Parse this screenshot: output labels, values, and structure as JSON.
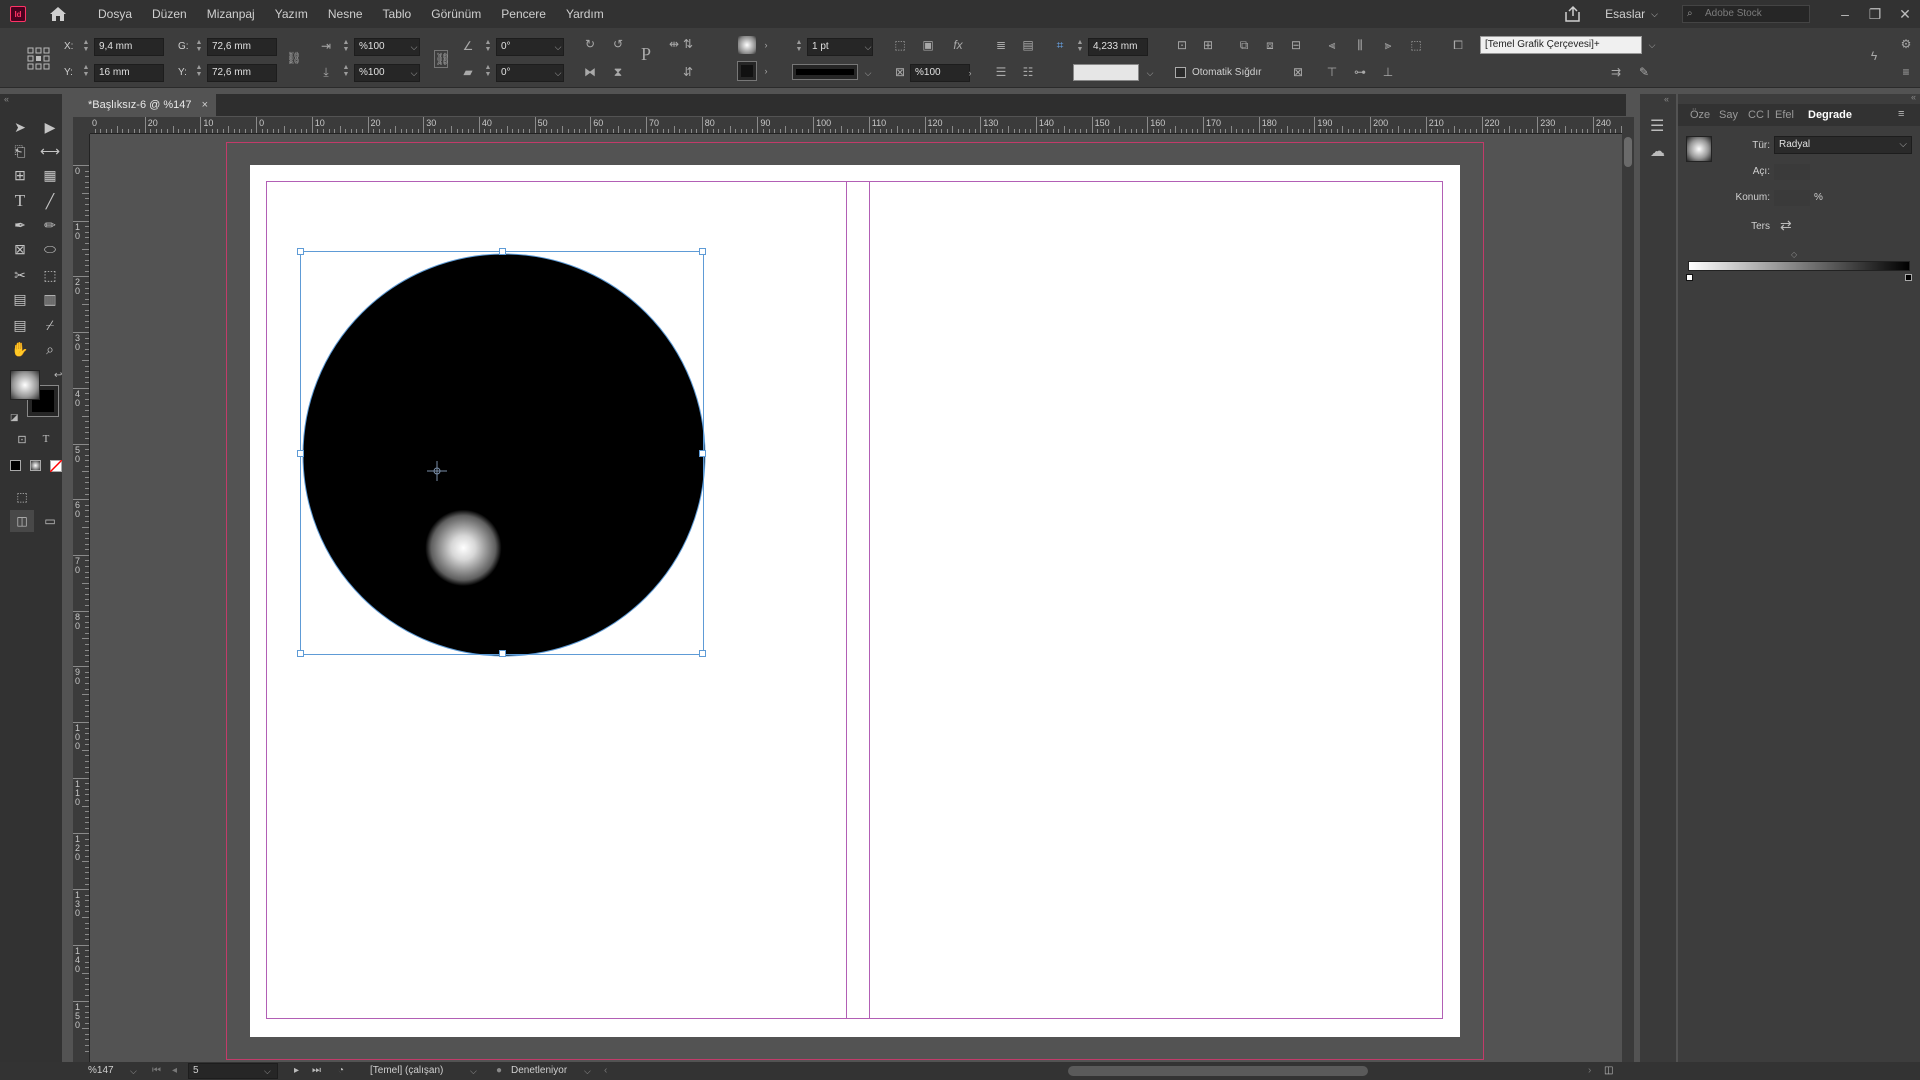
{
  "app": {
    "logo": "Id"
  },
  "menu": [
    "Dosya",
    "Düzen",
    "Mizanpaj",
    "Yazım",
    "Nesne",
    "Tablo",
    "Görünüm",
    "Pencere",
    "Yardım"
  ],
  "workspace": "Esaslar",
  "search_placeholder": "Adobe Stock",
  "control": {
    "x_label": "X:",
    "x_value": "9,4 mm",
    "y_label": "Y:",
    "y_value": "16 mm",
    "w_label": "G:",
    "w_value": "72,6 mm",
    "h_label": "Y:",
    "h_value": "72,6 mm",
    "scale_x": "%100",
    "scale_y": "%100",
    "rotate": "0°",
    "shear": "0°",
    "stroke_weight": "1 pt",
    "opacity": "%100",
    "offset": "4,233 mm",
    "auto_fit": "Otomatik Sığdır",
    "object_style": "[Temel Grafik Çerçevesi]+"
  },
  "document_tab": {
    "title": "*Başlıksız-6 @ %147",
    "close": "×"
  },
  "ruler_h": [
    "0",
    "20",
    "10",
    "0",
    "10",
    "20",
    "30",
    "40",
    "50",
    "60",
    "70",
    "80",
    "90",
    "100",
    "110",
    "120",
    "130",
    "140",
    "150",
    "160",
    "170",
    "180",
    "190",
    "200",
    "210",
    "220",
    "230",
    "240"
  ],
  "ruler_v": [
    "0",
    "1 0",
    "2 0",
    "3 0",
    "4 0",
    "5 0",
    "6 0",
    "7 0",
    "8 0",
    "9 0",
    "1 0 0",
    "1 1 0",
    "1 2 0",
    "1 3 0",
    "1 4 0",
    "1 5 0"
  ],
  "panel": {
    "tabs": [
      "Öze",
      "Say",
      "CC l",
      "Efel",
      "Degrade"
    ],
    "active_tab": "Degrade",
    "type_label": "Tür:",
    "type_value": "Radyal",
    "angle_label": "Açı:",
    "location_label": "Konum:",
    "location_unit": "%",
    "reverse_label": "Ters"
  },
  "status": {
    "zoom": "%147",
    "page": "5",
    "master": "[Temel] (çalışan)",
    "preflight": "Denetleniyor"
  },
  "colors": {
    "accent_pink": "#c23b6a",
    "margin_purple": "#b25fb5",
    "selection_blue": "#5e9bd6"
  }
}
